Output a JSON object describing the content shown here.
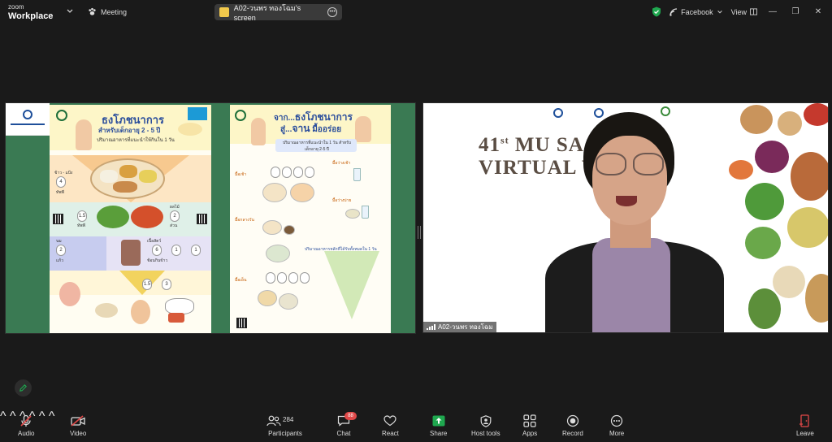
{
  "app": {
    "brand_small": "zoom",
    "brand_big": "Workplace",
    "meeting_label": "Meeting"
  },
  "share_pill": {
    "label": "A02-วนพร ทองโฉม's screen"
  },
  "top_right": {
    "facebook_label": "Facebook",
    "view_label": "View"
  },
  "shared_screen": {
    "poster1": {
      "title": "ธงโภชนาการ",
      "subtitle": "สำหรับเด็กอายุ 2 - 5 ปี",
      "caption": "ปริมาณอาหารที่แนะนำให้กินใน 1 วัน",
      "rice_label": "ข้าว - แป้ง",
      "rice_value": "4",
      "rice_unit": "ทัพพี",
      "veg_value": "1.5",
      "veg_unit": "ทัพพี",
      "fruit_label": "ผลไม้",
      "fruit_value": "2",
      "fruit_unit": "ส่วน",
      "milk_label": "นม",
      "milk_value": "2",
      "milk_unit": "แก้ว",
      "meat_label": "เนื้อสัตว์",
      "meat_value": "6",
      "meat_unit": "ช้อนกินข้าว",
      "egg_value": "1",
      "oil_value": "1.5",
      "sugar_value": "3"
    },
    "poster2": {
      "title_pre": "จาก...",
      "title_main": "ธงโภชนาการ",
      "title_line2_pre": "สู่...",
      "title_line2_main": "จาน",
      "title_line2_post": "มื้ออร่อย",
      "caption": "ปริมาณอาหารที่แนะนำใน 1 วัน สำหรับเด็กอายุ 2-5 ปี",
      "meal1_label": "มื้อเช้า",
      "meal2_label": "มื้อกลางวัน",
      "meal3_label": "มื้อเย็น",
      "snack1_label": "มื้อว่างเช้า",
      "snack2_label": "มื้อว่างบ่าย",
      "pyramid_caption": "ปริมาณอาหารหลักที่ได้รับทั้งหมดใน 1 วัน"
    }
  },
  "video": {
    "title_line1": "41",
    "title_sup": "st",
    "title_line1_rest": " MU SA    OOL",
    "title_line2": "VIRTUAL W    HOP",
    "participant_name": "A02-วนพร ทองโฉม"
  },
  "toolbar": {
    "audio": "Audio",
    "video": "Video",
    "participants": "Participants",
    "participants_count": "284",
    "chat": "Chat",
    "chat_badge": "88",
    "react": "React",
    "share": "Share",
    "host_tools": "Host tools",
    "apps": "Apps",
    "record": "Record",
    "more": "More",
    "leave": "Leave"
  },
  "colors": {
    "accent_green": "#1fa84f",
    "leave_red": "#e04848",
    "screen_bg": "#3a7a53"
  }
}
